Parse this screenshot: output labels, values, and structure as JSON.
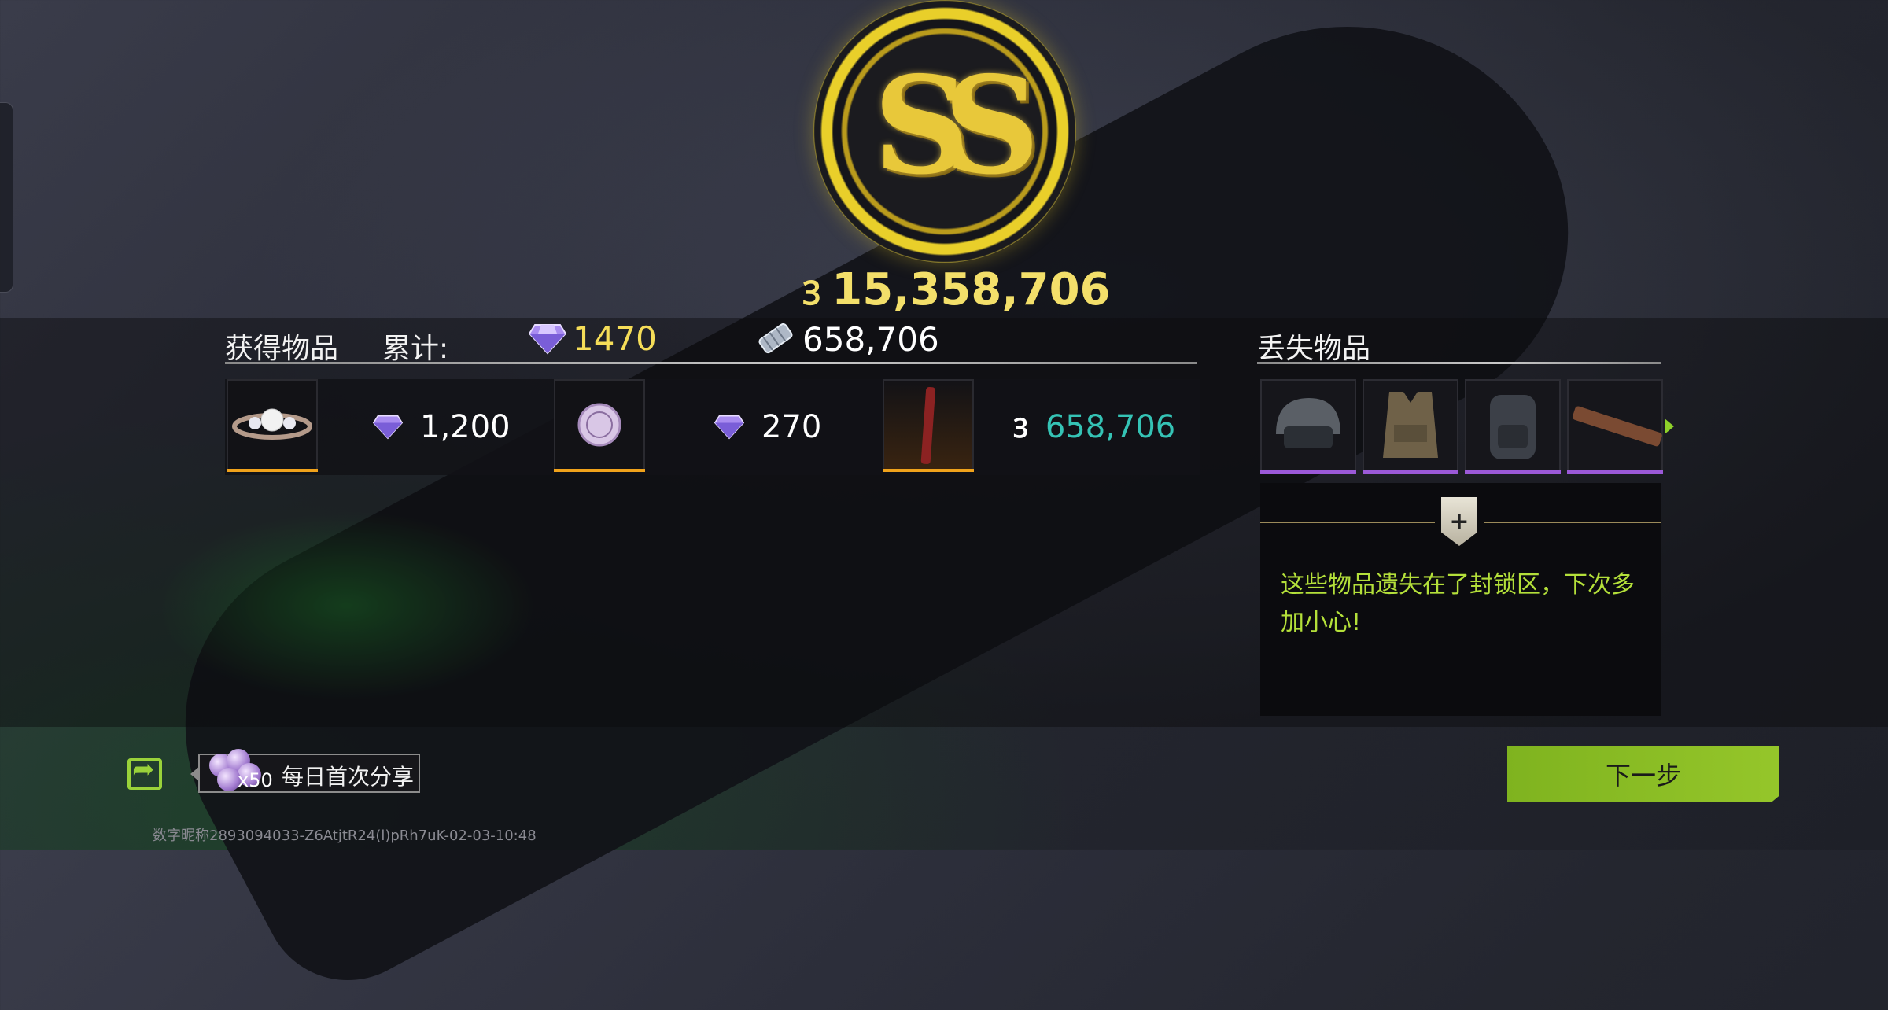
{
  "hero": {
    "currency_symbol": "Ꝫ",
    "total_value": "15,358,706",
    "medal_letters": "SS"
  },
  "gained": {
    "title": "获得物品",
    "cumulative_label": "累计:",
    "diamond_total": "1470",
    "cash_total": "658,706",
    "items": [
      {
        "name": "diamond ring",
        "value": "1,200",
        "value_icon": "diamond-icon"
      },
      {
        "name": "pearl coin",
        "value": "270",
        "value_icon": "diamond-icon"
      },
      {
        "name": "red flare stick",
        "value": "658,706",
        "value_icon": "koen-currency-icon"
      }
    ]
  },
  "lost": {
    "title": "丢失物品",
    "items": [
      "tactical helmet",
      "combat vest",
      "backpack",
      "rifle"
    ],
    "message": "这些物品遗失在了封锁区，下次多加小心!"
  },
  "share": {
    "reward_count": "x50",
    "label": "每日首次分享"
  },
  "next_button": "下一步",
  "watermark": "数字昵称2893094033-Z6AtjtR24(l)pRh7uK-02-03-10:48",
  "colors": {
    "gold": "#f5dd58",
    "teal": "#35c3b5",
    "accent_green": "#8fc325",
    "rarity_orange": "#f0a21b",
    "rarity_purple": "#9b59d8"
  }
}
